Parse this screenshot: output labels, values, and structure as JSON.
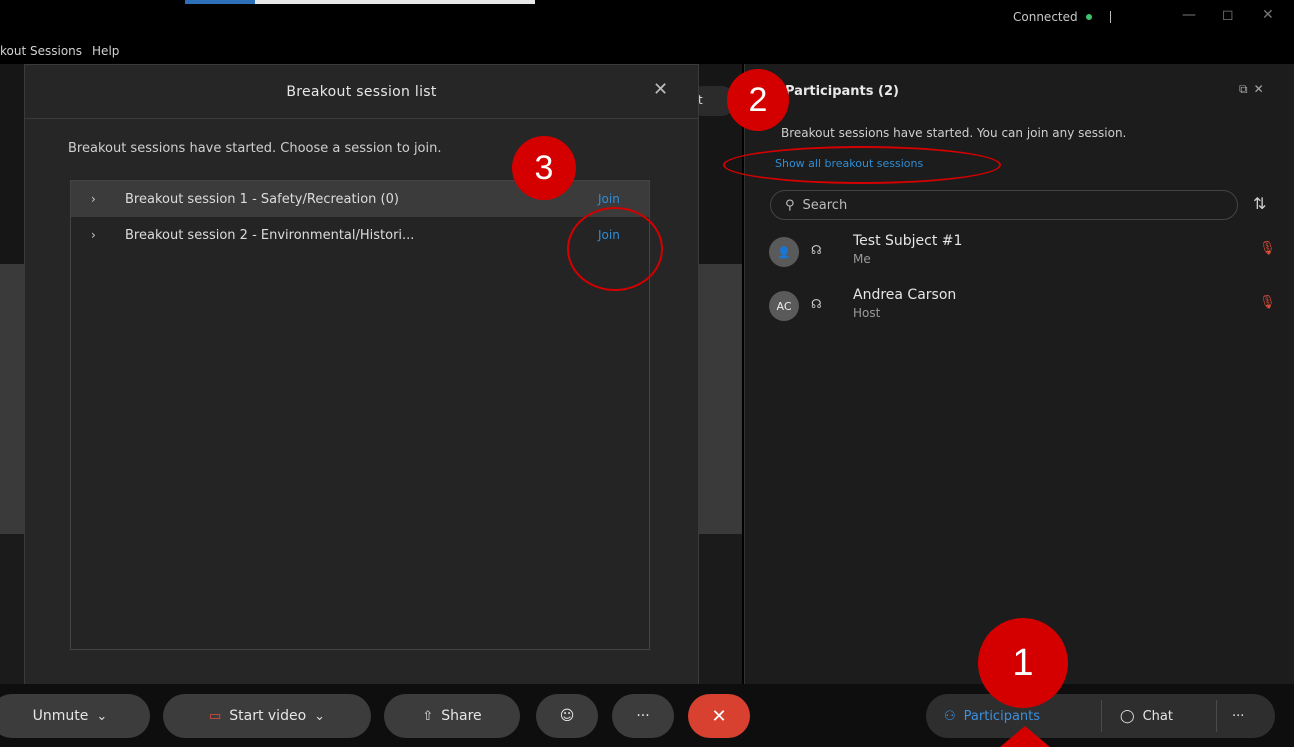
{
  "window": {
    "status_text": "Connected",
    "menu": [
      "kout Sessions",
      "Help"
    ],
    "controls": [
      "—",
      "◻",
      "✕"
    ]
  },
  "background": {
    "pill_text": "t"
  },
  "dialog": {
    "title": "Breakout session list",
    "close": "✕",
    "intro": "Breakout sessions have started. Choose a session to join.",
    "sessions": [
      {
        "name": "Breakout session 1 - Safety/Recreation (0)",
        "join": "Join"
      },
      {
        "name": "Breakout session 2 - Environmental/Histori...",
        "join": "Join"
      }
    ]
  },
  "participants_panel": {
    "title": "Participants (2)",
    "popout": "⧉",
    "close": "✕",
    "notice": "Breakout sessions have started. You can join any session.",
    "show_all": "Show all breakout sessions",
    "search_placeholder": "Search",
    "people": [
      {
        "initials": "",
        "name": "Test Subject #1",
        "role": "Me"
      },
      {
        "initials": "AC",
        "name": "Andrea Carson",
        "role": "Host"
      }
    ]
  },
  "controls": {
    "unmute": "Unmute",
    "start_video": "Start video",
    "share": "Share",
    "more": "···",
    "end": "✕",
    "participants": "Participants",
    "chat": "Chat",
    "more_right": "···"
  },
  "annotations": [
    "1",
    "2",
    "3"
  ],
  "colors": {
    "accent": "#2f8dd6",
    "annotation": "#d40000",
    "end_call": "#d8412f",
    "muted_mic": "#e04b3a",
    "connected": "#3cc46b"
  }
}
